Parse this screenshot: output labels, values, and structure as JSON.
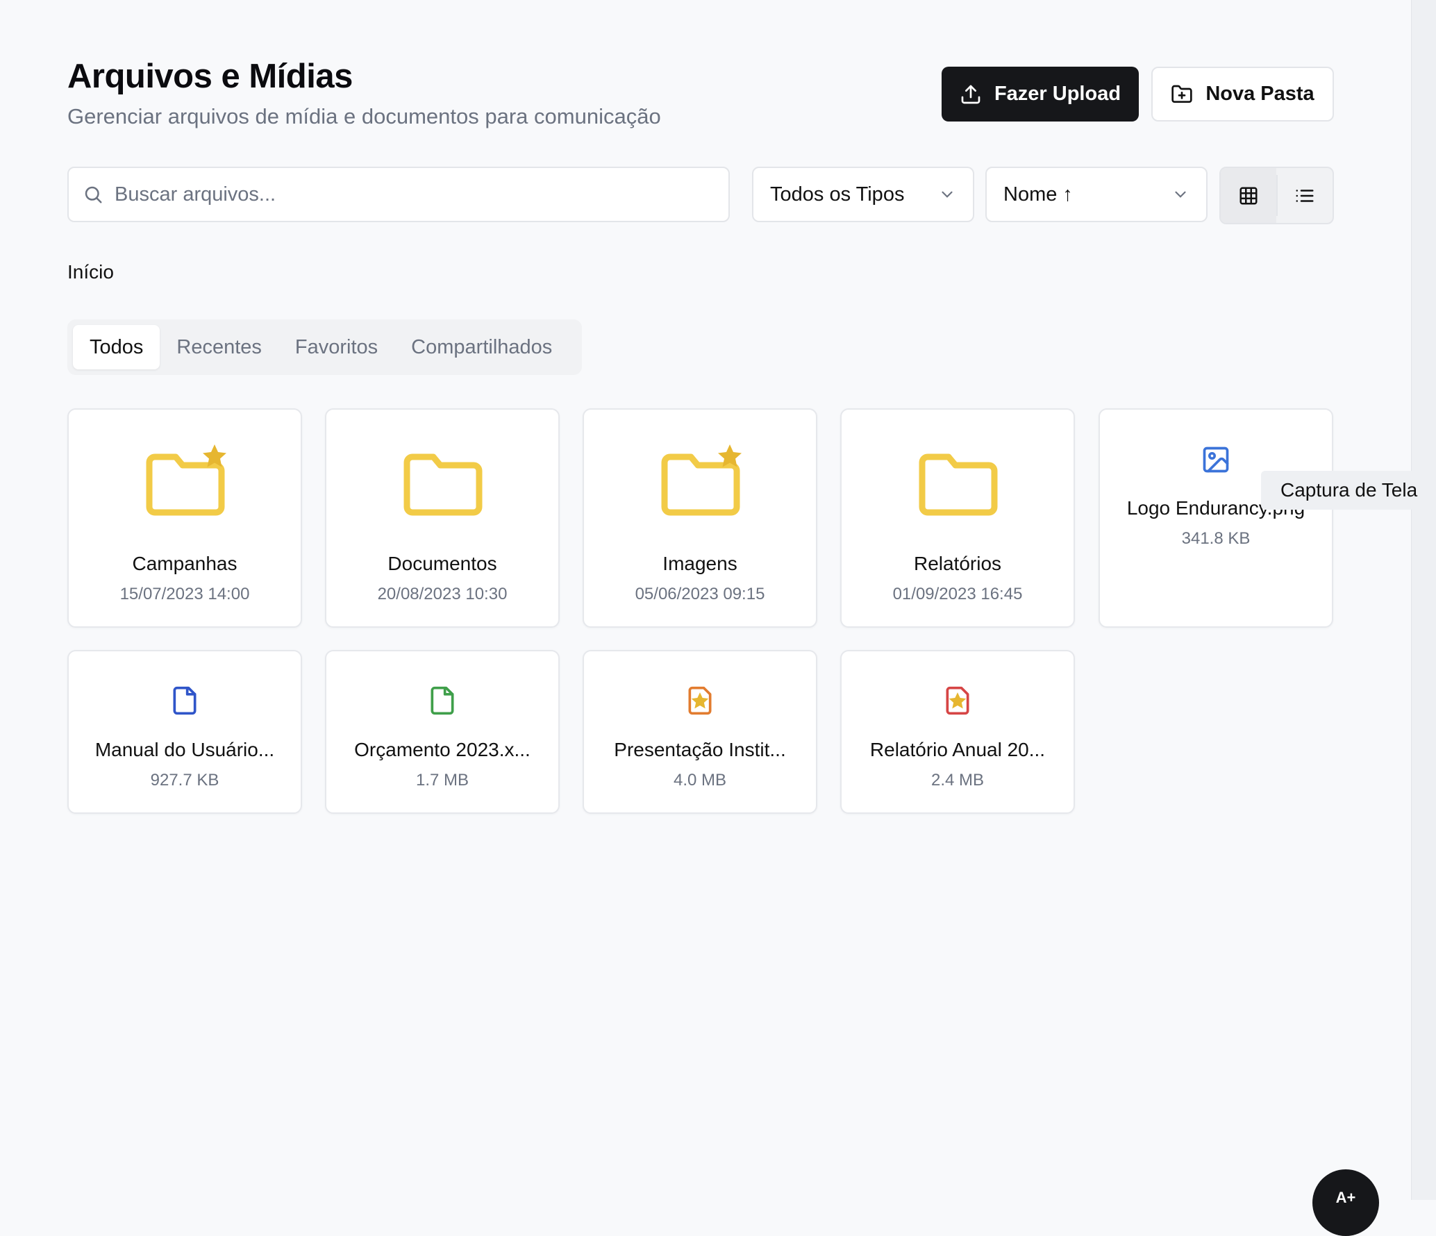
{
  "header": {
    "title": "Arquivos e Mídias",
    "subtitle": "Gerenciar arquivos de mídia e documentos para comunicação",
    "upload_label": "Fazer Upload",
    "new_folder_label": "Nova Pasta"
  },
  "search": {
    "placeholder": "Buscar arquivos..."
  },
  "filters": {
    "type_label": "Todos os Tipos",
    "sort_label": "Nome ↑"
  },
  "breadcrumb": "Início",
  "tabs": [
    "Todos",
    "Recentes",
    "Favoritos",
    "Compartilhados"
  ],
  "folders": [
    {
      "name": "Campanhas",
      "date": "15/07/2023 14:00",
      "favorite": true
    },
    {
      "name": "Documentos",
      "date": "20/08/2023 10:30",
      "favorite": false
    },
    {
      "name": "Imagens",
      "date": "05/06/2023 09:15",
      "favorite": true
    },
    {
      "name": "Relatórios",
      "date": "01/09/2023 16:45",
      "favorite": false
    }
  ],
  "files": [
    {
      "name": "Logo Endurancy.png",
      "size": "341.8 KB",
      "icon": "image-icon",
      "color": "#3b73d9"
    },
    {
      "name": "Manual do Usuário...",
      "size": "927.7 KB",
      "icon": "document-icon",
      "color": "#2f55c9"
    },
    {
      "name": "Orçamento 2023.x...",
      "size": "1.7 MB",
      "icon": "spreadsheet-icon",
      "color": "#3f9f4a"
    },
    {
      "name": "Presentação Instit...",
      "size": "4.0 MB",
      "icon": "presentation-icon",
      "color": "#e27c2f",
      "favorite": true
    },
    {
      "name": "Relatório Anual 20...",
      "size": "2.4 MB",
      "icon": "pdf-icon",
      "color": "#d64545",
      "favorite": true
    }
  ],
  "tooltip": "Captura de Tela",
  "fab_label": "A+",
  "colors": {
    "folder": "#f2cb47",
    "star": "#e6b630",
    "primary": "#16171a"
  }
}
